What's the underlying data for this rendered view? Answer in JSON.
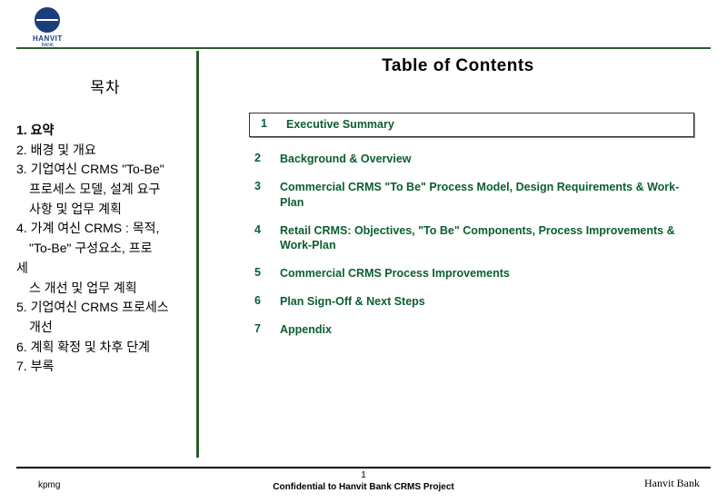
{
  "logo": {
    "name": "HANVIT",
    "sub": "BANK"
  },
  "left": {
    "title": "목차",
    "items": [
      {
        "text": "1. 요약",
        "bold": true
      },
      {
        "text": "2. 배경 및 개요"
      },
      {
        "text": "3. 기업여신 CRMS \"To-Be\""
      },
      {
        "text": "프로세스 모델, 설계 요구",
        "indent": true
      },
      {
        "text": "사항 및 업무 계획",
        "indent": true
      },
      {
        "text": "4. 가계 여신 CRMS : 목적,"
      },
      {
        "text": "\"To-Be\" 구성요소, 프로",
        "indent": true
      },
      {
        "text": "세"
      },
      {
        "text": "스 개선 및 업무 계획",
        "indent": true
      },
      {
        "text": "5. 기업여신 CRMS 프로세스"
      },
      {
        "text": "개선",
        "indent": true
      },
      {
        "text": "6. 계획 확정 및 차후 단계"
      },
      {
        "text": "7. 부록"
      }
    ]
  },
  "right": {
    "title": "Table of Contents",
    "toc": [
      {
        "num": "1",
        "text": "Executive Summary",
        "boxed": true
      },
      {
        "num": "2",
        "text": "Background & Overview"
      },
      {
        "num": "3",
        "text": "Commercial CRMS \"To Be\" Process Model, Design Requirements & Work-Plan"
      },
      {
        "num": "4",
        "text": "Retail CRMS: Objectives, \"To Be\" Components, Process Improvements & Work-Plan"
      },
      {
        "num": "5",
        "text": "Commercial CRMS Process Improvements"
      },
      {
        "num": "6",
        "text": "Plan Sign-Off & Next Steps"
      },
      {
        "num": "7",
        "text": "Appendix"
      }
    ]
  },
  "footer": {
    "left": "kpmg",
    "page": "1",
    "mid": "Confidential to Hanvit Bank CRMS Project",
    "right": "Hanvit Bank"
  }
}
